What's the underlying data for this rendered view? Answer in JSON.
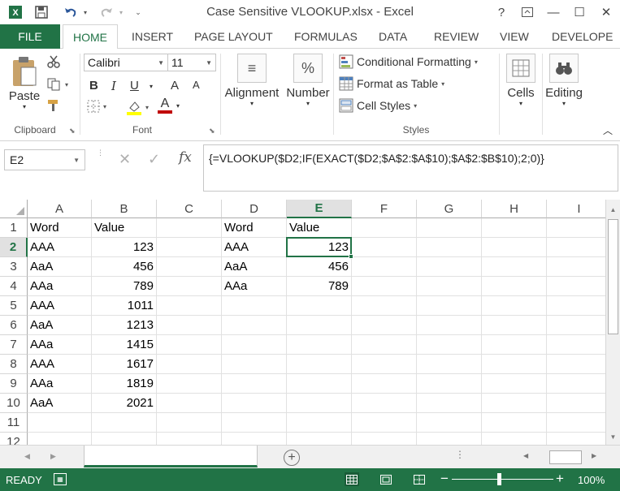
{
  "window": {
    "title": "Case Sensitive VLOOKUP.xlsx - Excel",
    "help": "?",
    "minimize": "—",
    "restore": "☐",
    "close": "✕"
  },
  "ribbon_tabs": {
    "file": "FILE",
    "items": [
      "HOME",
      "INSERT",
      "PAGE LAYOUT",
      "FORMULAS",
      "DATA",
      "REVIEW",
      "VIEW",
      "DEVELOPE"
    ],
    "active": "HOME"
  },
  "clipboard": {
    "paste": "Paste",
    "label": "Clipboard"
  },
  "font_group": {
    "font_name": "Calibri",
    "font_size": "11",
    "bold": "B",
    "italic": "I",
    "underline": "U",
    "grow": "A",
    "shrink": "A",
    "font_color_glyph": "A",
    "label": "Font"
  },
  "alignment": {
    "label": "Alignment",
    "icon": "≡"
  },
  "number": {
    "label": "Number",
    "icon": "%"
  },
  "styles": {
    "conditional_formatting": "Conditional Formatting",
    "format_as_table": "Format as Table",
    "cell_styles": "Cell Styles",
    "label": "Styles"
  },
  "cells": {
    "label": "Cells"
  },
  "editing": {
    "label": "Editing"
  },
  "formula_bar": {
    "name_box": "E2",
    "fx": "fx",
    "formula": "{=VLOOKUP($D2;IF(EXACT($D2;$A$2:$A$10);$A$2:$B$10);2;0)}"
  },
  "grid": {
    "columns": [
      "A",
      "B",
      "C",
      "D",
      "E",
      "F",
      "G",
      "H",
      "I"
    ],
    "selected_column": "E",
    "rows": [
      "1",
      "2",
      "3",
      "4",
      "5",
      "6",
      "7",
      "8",
      "9",
      "10",
      "11",
      "12"
    ],
    "selected_row": "2",
    "cells": {
      "A1": "Word",
      "B1": "Value",
      "D1": "Word",
      "E1": "Value",
      "A2": "AAA",
      "B2": "123",
      "D2": "AAA",
      "E2": "123",
      "A3": "AaA",
      "B3": "456",
      "D3": "AaA",
      "E3": "456",
      "A4": "AAa",
      "B4": "789",
      "D4": "AAa",
      "E4": "789",
      "A5": "AAA",
      "B5": "1011",
      "A6": "AaA",
      "B6": "1213",
      "A7": "AAa",
      "B7": "1415",
      "A8": "AAA",
      "B8": "1617",
      "A9": "AAa",
      "B9": "1819",
      "A10": "AaA",
      "B10": "2021"
    },
    "numeric_cells": [
      "B2",
      "B3",
      "B4",
      "B5",
      "B6",
      "B7",
      "B8",
      "B9",
      "B10",
      "E2",
      "E3",
      "E4"
    ],
    "selected_cell": "E2"
  },
  "sheet_bar": {
    "add_sheet": "+"
  },
  "status_bar": {
    "status": "READY",
    "zoom_level": "100%",
    "zoom_fraction": 0.46
  },
  "colors": {
    "accent": "#217346",
    "font_color_underline": "#c00000",
    "fill_color_underline": "#ffff00"
  }
}
